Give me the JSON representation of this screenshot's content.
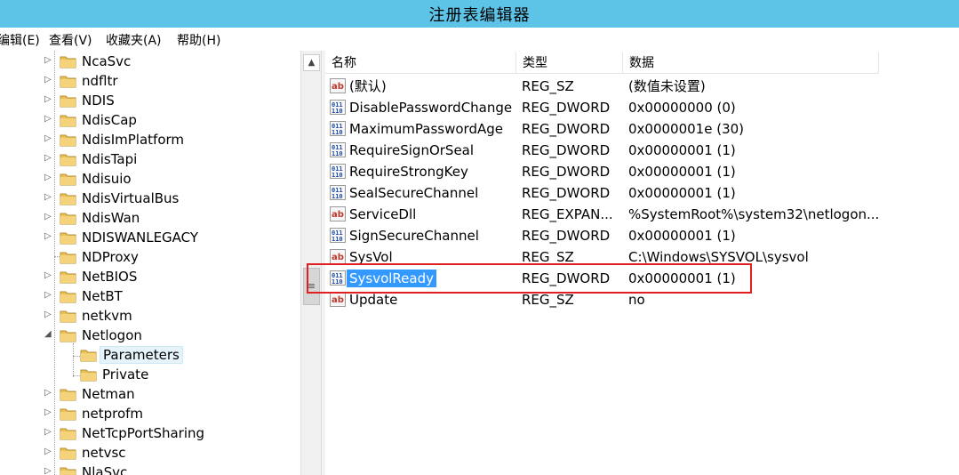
{
  "window": {
    "title": "注册表编辑器"
  },
  "menu": [
    {
      "label": "编辑(E)"
    },
    {
      "label": "查看(V)"
    },
    {
      "label": "收藏夹(A)"
    },
    {
      "label": "帮助(H)"
    }
  ],
  "tree": [
    {
      "label": "NcaSvc",
      "expander": "▷"
    },
    {
      "label": "ndfltr",
      "expander": "▷"
    },
    {
      "label": "NDIS",
      "expander": "▷"
    },
    {
      "label": "NdisCap",
      "expander": "▷"
    },
    {
      "label": "NdisImPlatform",
      "expander": "▷"
    },
    {
      "label": "NdisTapi",
      "expander": "▷"
    },
    {
      "label": "Ndisuio",
      "expander": "▷"
    },
    {
      "label": "NdisVirtualBus",
      "expander": "▷"
    },
    {
      "label": "NdisWan",
      "expander": "▷"
    },
    {
      "label": "NDISWANLEGACY",
      "expander": "▷"
    },
    {
      "label": "NDProxy",
      "expander": ""
    },
    {
      "label": "NetBIOS",
      "expander": "▷"
    },
    {
      "label": "NetBT",
      "expander": "▷"
    },
    {
      "label": "netkvm",
      "expander": "▷"
    },
    {
      "label": "Netlogon",
      "expander": "◢"
    },
    {
      "label": "Parameters",
      "expander": ""
    },
    {
      "label": "Private",
      "expander": ""
    },
    {
      "label": "Netman",
      "expander": "▷"
    },
    {
      "label": "netprofm",
      "expander": "▷"
    },
    {
      "label": "NetTcpPortSharing",
      "expander": "▷"
    },
    {
      "label": "netvsc",
      "expander": "▷"
    },
    {
      "label": "NlaSvc",
      "expander": "▷"
    }
  ],
  "columns": {
    "name": "名称",
    "type": "类型",
    "data": "数据"
  },
  "values": [
    {
      "name": "(默认)",
      "type": "REG_SZ",
      "data": "(数值未设置)",
      "icon": "string-value-icon"
    },
    {
      "name": "DisablePasswordChange",
      "type": "REG_DWORD",
      "data": "0x00000000 (0)",
      "icon": "binary-value-icon"
    },
    {
      "name": "MaximumPasswordAge",
      "type": "REG_DWORD",
      "data": "0x0000001e (30)",
      "icon": "binary-value-icon"
    },
    {
      "name": "RequireSignOrSeal",
      "type": "REG_DWORD",
      "data": "0x00000001 (1)",
      "icon": "binary-value-icon"
    },
    {
      "name": "RequireStrongKey",
      "type": "REG_DWORD",
      "data": "0x00000001 (1)",
      "icon": "binary-value-icon"
    },
    {
      "name": "SealSecureChannel",
      "type": "REG_DWORD",
      "data": "0x00000001 (1)",
      "icon": "binary-value-icon"
    },
    {
      "name": "ServiceDll",
      "type": "REG_EXPAN...",
      "data": "%SystemRoot%\\system32\\netlogon...",
      "icon": "string-value-icon"
    },
    {
      "name": "SignSecureChannel",
      "type": "REG_DWORD",
      "data": "0x00000001 (1)",
      "icon": "binary-value-icon"
    },
    {
      "name": "SysVol",
      "type": "REG_SZ",
      "data": "C:\\Windows\\SYSVOL\\sysvol",
      "icon": "string-value-icon"
    },
    {
      "name": "SysvolReady",
      "type": "REG_DWORD",
      "data": "0x00000001 (1)",
      "icon": "binary-value-icon"
    },
    {
      "name": "Update",
      "type": "REG_SZ",
      "data": "no",
      "icon": "string-value-icon"
    }
  ],
  "colors": {
    "titlebar": "#5dc4e8",
    "selection": "#3399ff",
    "highlight_box": "#e02020"
  }
}
